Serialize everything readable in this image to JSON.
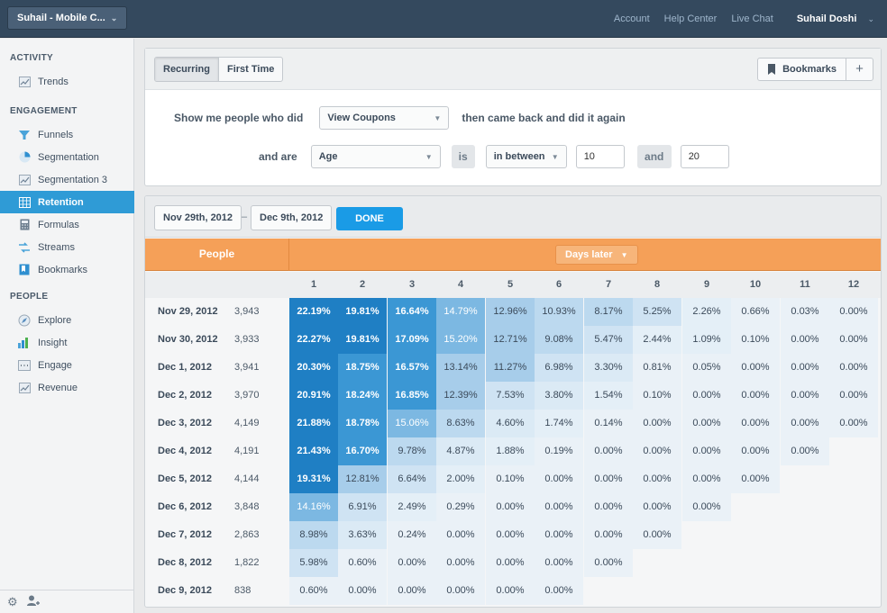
{
  "app": {
    "project_label": "Suhail - Mobile C...",
    "top_links": [
      "Account",
      "Help Center",
      "Live Chat"
    ],
    "user_name": "Suhail Doshi"
  },
  "sidebar": {
    "sections": [
      {
        "title": "ACTIVITY",
        "items": [
          {
            "label": "Trends",
            "icon": "trends-icon"
          }
        ]
      },
      {
        "title": "ENGAGEMENT",
        "items": [
          {
            "label": "Funnels",
            "icon": "funnel-icon"
          },
          {
            "label": "Segmentation",
            "icon": "pie-chart-icon"
          },
          {
            "label": "Segmentation 3",
            "icon": "trends-icon"
          },
          {
            "label": "Retention",
            "icon": "grid-icon",
            "active": true
          },
          {
            "label": "Formulas",
            "icon": "calculator-icon"
          },
          {
            "label": "Streams",
            "icon": "streams-icon"
          },
          {
            "label": "Bookmarks",
            "icon": "bookmark-icon"
          }
        ]
      },
      {
        "title": "PEOPLE",
        "items": [
          {
            "label": "Explore",
            "icon": "explore-icon"
          },
          {
            "label": "Insight",
            "icon": "insight-icon"
          },
          {
            "label": "Engage",
            "icon": "engage-icon"
          },
          {
            "label": "Revenue",
            "icon": "trends-icon"
          }
        ]
      }
    ]
  },
  "query": {
    "tabs": [
      "Recurring",
      "First Time"
    ],
    "active_tab": "Recurring",
    "bookmarks_label": "Bookmarks",
    "line1_prefix": "Show me people who did",
    "event": "View Coupons",
    "line1_suffix": "then came back and did it again",
    "line2_prefix": "and are",
    "property": "Age",
    "is_label": "is",
    "operator": "in between",
    "value_from": "10",
    "and_label": "and",
    "value_to": "20"
  },
  "retention": {
    "date_from": "Nov 29th, 2012",
    "date_sep": "–",
    "date_to": "Dec 9th, 2012",
    "done_label": "DONE",
    "people_header": "People",
    "days_later_label": "Days later",
    "day_headers": [
      "1",
      "2",
      "3",
      "4",
      "5",
      "6",
      "7",
      "8",
      "9",
      "10",
      "11",
      "12"
    ],
    "rows": [
      {
        "date": "Nov 29, 2012",
        "count": "3,943",
        "values": [
          "22.19%",
          "19.81%",
          "16.64%",
          "14.79%",
          "12.96%",
          "10.93%",
          "8.17%",
          "5.25%",
          "2.26%",
          "0.66%",
          "0.03%",
          "0.00%"
        ]
      },
      {
        "date": "Nov 30, 2012",
        "count": "3,933",
        "values": [
          "22.27%",
          "19.81%",
          "17.09%",
          "15.20%",
          "12.71%",
          "9.08%",
          "5.47%",
          "2.44%",
          "1.09%",
          "0.10%",
          "0.00%",
          "0.00%"
        ]
      },
      {
        "date": "Dec 1, 2012",
        "count": "3,941",
        "values": [
          "20.30%",
          "18.75%",
          "16.57%",
          "13.14%",
          "11.27%",
          "6.98%",
          "3.30%",
          "0.81%",
          "0.05%",
          "0.00%",
          "0.00%",
          "0.00%"
        ]
      },
      {
        "date": "Dec 2, 2012",
        "count": "3,970",
        "values": [
          "20.91%",
          "18.24%",
          "16.85%",
          "12.39%",
          "7.53%",
          "3.80%",
          "1.54%",
          "0.10%",
          "0.00%",
          "0.00%",
          "0.00%",
          "0.00%"
        ]
      },
      {
        "date": "Dec 3, 2012",
        "count": "4,149",
        "values": [
          "21.88%",
          "18.78%",
          "15.06%",
          "8.63%",
          "4.60%",
          "1.74%",
          "0.14%",
          "0.00%",
          "0.00%",
          "0.00%",
          "0.00%",
          "0.00%"
        ]
      },
      {
        "date": "Dec 4, 2012",
        "count": "4,191",
        "values": [
          "21.43%",
          "16.70%",
          "9.78%",
          "4.87%",
          "1.88%",
          "0.19%",
          "0.00%",
          "0.00%",
          "0.00%",
          "0.00%",
          "0.00%"
        ]
      },
      {
        "date": "Dec 5, 2012",
        "count": "4,144",
        "values": [
          "19.31%",
          "12.81%",
          "6.64%",
          "2.00%",
          "0.10%",
          "0.00%",
          "0.00%",
          "0.00%",
          "0.00%",
          "0.00%"
        ]
      },
      {
        "date": "Dec 6, 2012",
        "count": "3,848",
        "values": [
          "14.16%",
          "6.91%",
          "2.49%",
          "0.29%",
          "0.00%",
          "0.00%",
          "0.00%",
          "0.00%",
          "0.00%"
        ]
      },
      {
        "date": "Dec 7, 2012",
        "count": "2,863",
        "values": [
          "8.98%",
          "3.63%",
          "0.24%",
          "0.00%",
          "0.00%",
          "0.00%",
          "0.00%",
          "0.00%"
        ]
      },
      {
        "date": "Dec 8, 2012",
        "count": "1,822",
        "values": [
          "5.98%",
          "0.60%",
          "0.00%",
          "0.00%",
          "0.00%",
          "0.00%",
          "0.00%"
        ]
      },
      {
        "date": "Dec 9, 2012",
        "count": "838",
        "values": [
          "0.60%",
          "0.00%",
          "0.00%",
          "0.00%",
          "0.00%",
          "0.00%"
        ]
      }
    ]
  },
  "colors": {
    "sidebar_active": "#2f9bd6",
    "header_orange": "#f5a058",
    "done_blue": "#1a9be6",
    "topbar": "#34495e"
  }
}
